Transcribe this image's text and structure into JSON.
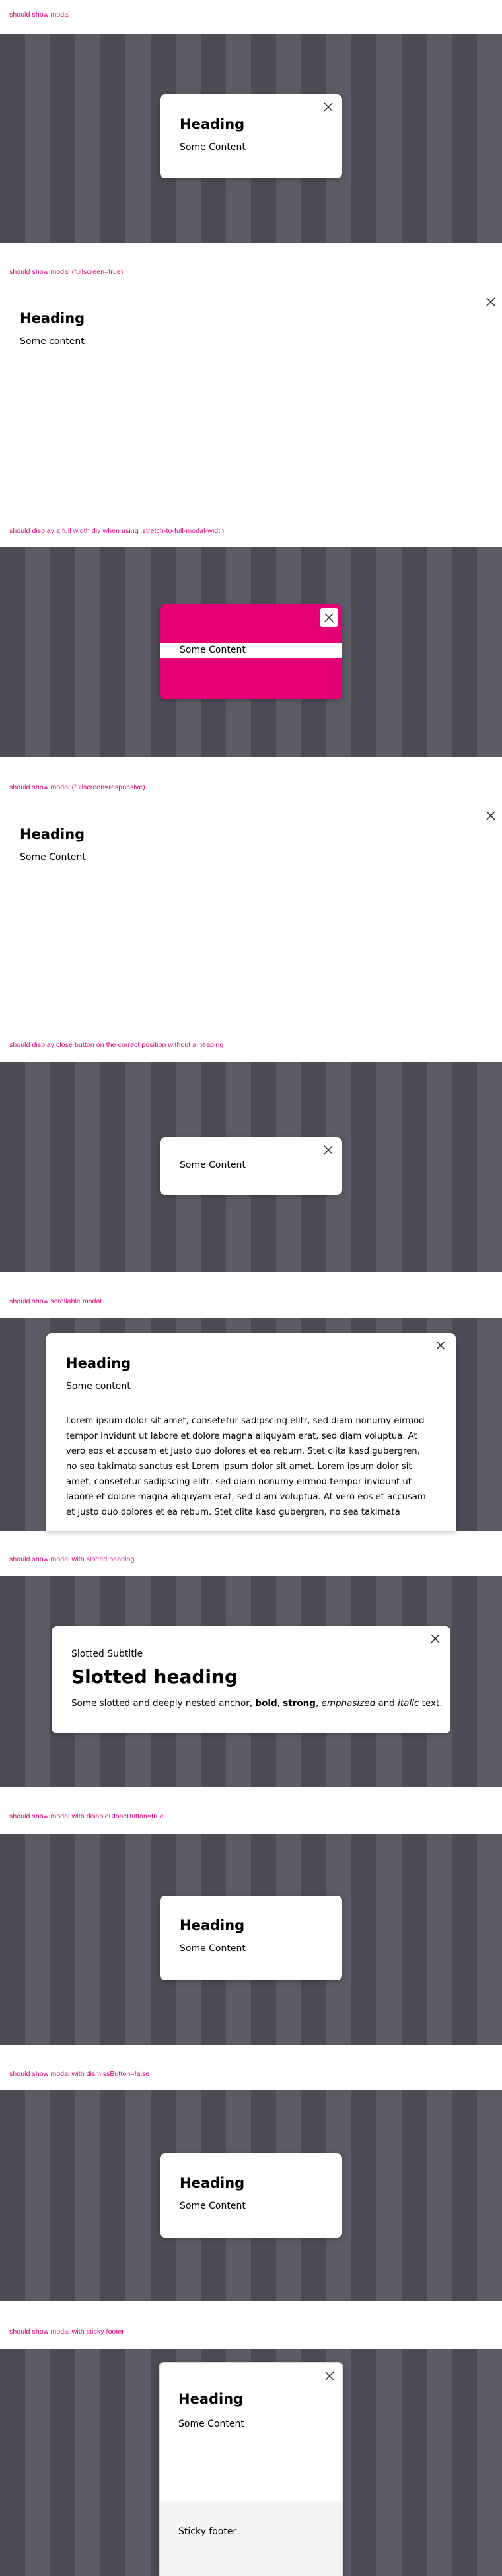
{
  "sections": {
    "s1": {
      "label": "should show modal",
      "heading": "Heading",
      "content": "Some Content"
    },
    "s2": {
      "label": "should show modal (fullscreen=true)",
      "heading": "Heading",
      "content": "Some content"
    },
    "s3": {
      "label": "should display a full width div when using .stretch-to-full-modal-width",
      "content": "Some Content",
      "accent": "#e20074"
    },
    "s4": {
      "label": "should show modal (fullscreen=responsive)",
      "heading": "Heading",
      "content": "Some Content"
    },
    "s5": {
      "label": "should display close button on the correct position without a heading",
      "content": "Some Content"
    },
    "s6": {
      "label": "should show scrollable modal",
      "heading": "Heading",
      "content": "Some content",
      "lorem_lines": [
        "Lorem ipsum dolor sit amet, consetetur sadipscing elitr, sed diam nonumy eirmod",
        "tempor invidunt ut labore et dolore magna aliquyam erat, sed diam voluptua. At",
        "vero eos et accusam et justo duo dolores et ea rebum. Stet clita kasd gubergren,",
        "no sea takimata sanctus est Lorem ipsum dolor sit amet. Lorem ipsum dolor sit",
        "amet, consetetur sadipscing elitr, sed diam nonumy eirmod tempor invidunt ut",
        "labore et dolore magna aliquyam erat, sed diam voluptua. At vero eos et accusam",
        "et justo duo dolores et ea rebum. Stet clita kasd gubergren, no sea takimata"
      ]
    },
    "s7": {
      "label": "should show modal with slotted heading",
      "subtitle": "Slotted Subtitle",
      "heading": "Slotted heading",
      "rich": {
        "p1": "Some slotted and deeply nested ",
        "anchor": "anchor",
        "p2": ", ",
        "bold": "bold",
        "p3": ", ",
        "strong": "strong",
        "p4": ", ",
        "emphasized": "emphasized",
        "p5": " and ",
        "italic": "italic",
        "p6": " text."
      }
    },
    "s8": {
      "label": "should show modal with disableCloseButton=true",
      "heading": "Heading",
      "content": "Some Content"
    },
    "s9": {
      "label": "should show modal with dismissButton=false",
      "heading": "Heading",
      "content": "Some Content"
    },
    "s10": {
      "label": "should show modal with sticky footer",
      "heading": "Heading",
      "content": "Some Content",
      "footer": "Sticky footer"
    }
  },
  "icons": {
    "close": "close-icon"
  },
  "colors": {
    "accent": "#e20074",
    "backdrop_dark": "#4c4c55",
    "backdrop_light": "#5c5c65"
  }
}
